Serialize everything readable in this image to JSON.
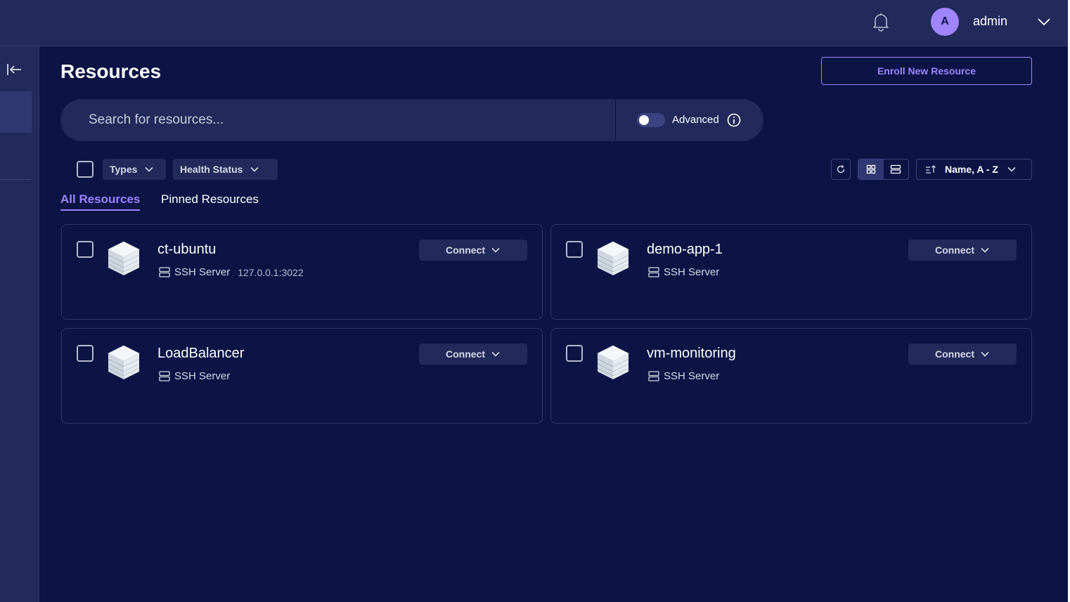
{
  "header": {
    "username": "admin",
    "avatar_initial": "A"
  },
  "page": {
    "title": "Resources",
    "enroll_label": "Enroll New Resource"
  },
  "search": {
    "placeholder": "Search for resources...",
    "advanced_label": "Advanced"
  },
  "filters": {
    "types_label": "Types",
    "health_label": "Health Status"
  },
  "sort": {
    "label": "Name, A - Z"
  },
  "tabs": [
    {
      "label": "All Resources"
    },
    {
      "label": "Pinned Resources"
    }
  ],
  "resources": [
    {
      "name": "ct-ubuntu",
      "kind": "SSH Server",
      "address": "127.0.0.1:3022",
      "connect_label": "Connect"
    },
    {
      "name": "demo-app-1",
      "kind": "SSH Server",
      "connect_label": "Connect"
    },
    {
      "name": "LoadBalancer",
      "kind": "SSH Server",
      "connect_label": "Connect"
    },
    {
      "name": "vm-monitoring",
      "kind": "SSH Server",
      "connect_label": "Connect"
    }
  ],
  "icons": {
    "notifications": "bell-icon",
    "user_menu": "chevron-down-icon",
    "sidebar_collapse": "collapse-sidebar-icon",
    "info": "info-icon",
    "refresh": "refresh-icon",
    "grid_view": "grid-view-icon",
    "list_view": "list-view-icon",
    "sort": "sort-ascending-icon",
    "server": "server-icon",
    "resource": "server-stack-icon"
  },
  "colors": {
    "background": "#0c1445",
    "surface": "#222a5b",
    "accent": "#9f85ff",
    "border": "#2f3870"
  }
}
